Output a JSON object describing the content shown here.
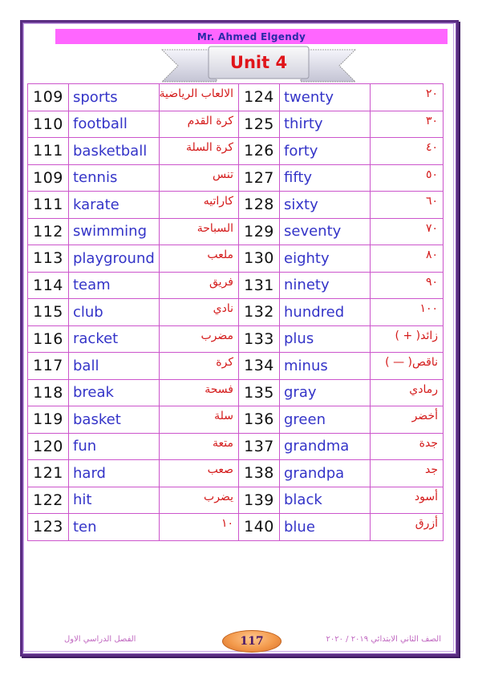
{
  "header": {
    "author": "Mr. Ahmed Elgendy",
    "unit_title": "Unit 4",
    "colors": {
      "header_bar": "#ff66ff",
      "author_text": "#2a2aa8",
      "unit_title": "#e0141a",
      "frame": "#5a2d82",
      "grid": "#cc55cc"
    }
  },
  "vocabulary": {
    "left": [
      {
        "num": "109",
        "en": "sports",
        "ar": "الالعاب الرياضية"
      },
      {
        "num": "110",
        "en": "football",
        "ar": "كرة القدم"
      },
      {
        "num": "111",
        "en": "basketball",
        "ar": "كرة السلة"
      },
      {
        "num": "109",
        "en": "tennis",
        "ar": "تنس"
      },
      {
        "num": "111",
        "en": "karate",
        "ar": "كاراتيه"
      },
      {
        "num": "112",
        "en": "swimming",
        "ar": "السباحة"
      },
      {
        "num": "113",
        "en": "playground",
        "ar": "ملعب"
      },
      {
        "num": "114",
        "en": "team",
        "ar": "فريق"
      },
      {
        "num": "115",
        "en": "club",
        "ar": "نادي"
      },
      {
        "num": "116",
        "en": "racket",
        "ar": "مضرب"
      },
      {
        "num": "117",
        "en": "ball",
        "ar": "كرة"
      },
      {
        "num": "118",
        "en": "break",
        "ar": "فسحة"
      },
      {
        "num": "119",
        "en": "basket",
        "ar": "سلة"
      },
      {
        "num": "120",
        "en": "fun",
        "ar": "متعة"
      },
      {
        "num": "121",
        "en": "hard",
        "ar": "صعب"
      },
      {
        "num": "122",
        "en": "hit",
        "ar": "يضرب"
      },
      {
        "num": "123",
        "en": "ten",
        "ar": "١٠"
      }
    ],
    "right": [
      {
        "num": "124",
        "en": "twenty",
        "ar": "٢٠"
      },
      {
        "num": "125",
        "en": "thirty",
        "ar": "٣٠"
      },
      {
        "num": "126",
        "en": "forty",
        "ar": "٤٠"
      },
      {
        "num": "127",
        "en": "fifty",
        "ar": "٥٠"
      },
      {
        "num": "128",
        "en": "sixty",
        "ar": "٦٠"
      },
      {
        "num": "129",
        "en": "seventy",
        "ar": "٧٠"
      },
      {
        "num": "130",
        "en": "eighty",
        "ar": "٨٠"
      },
      {
        "num": "131",
        "en": "ninety",
        "ar": "٩٠"
      },
      {
        "num": "132",
        "en": "hundred",
        "ar": "١٠٠"
      },
      {
        "num": "133",
        "en": "plus",
        "ar": "زائد( + )"
      },
      {
        "num": "134",
        "en": "minus",
        "ar": "ناقص( — )"
      },
      {
        "num": "135",
        "en": "gray",
        "ar": "رمادي"
      },
      {
        "num": "136",
        "en": "green",
        "ar": "أخضر"
      },
      {
        "num": "137",
        "en": "grandma",
        "ar": "جدة"
      },
      {
        "num": "138",
        "en": "grandpa",
        "ar": "جد"
      },
      {
        "num": "139",
        "en": "black",
        "ar": "أسود"
      },
      {
        "num": "140",
        "en": "blue",
        "ar": "أزرق"
      }
    ]
  },
  "footer": {
    "grade_year": "الصف الثاني الابتدائي ٢٠١٩ / ٢٠٢٠",
    "page_number": "117",
    "term": "الفصل الدراسي الاول"
  }
}
